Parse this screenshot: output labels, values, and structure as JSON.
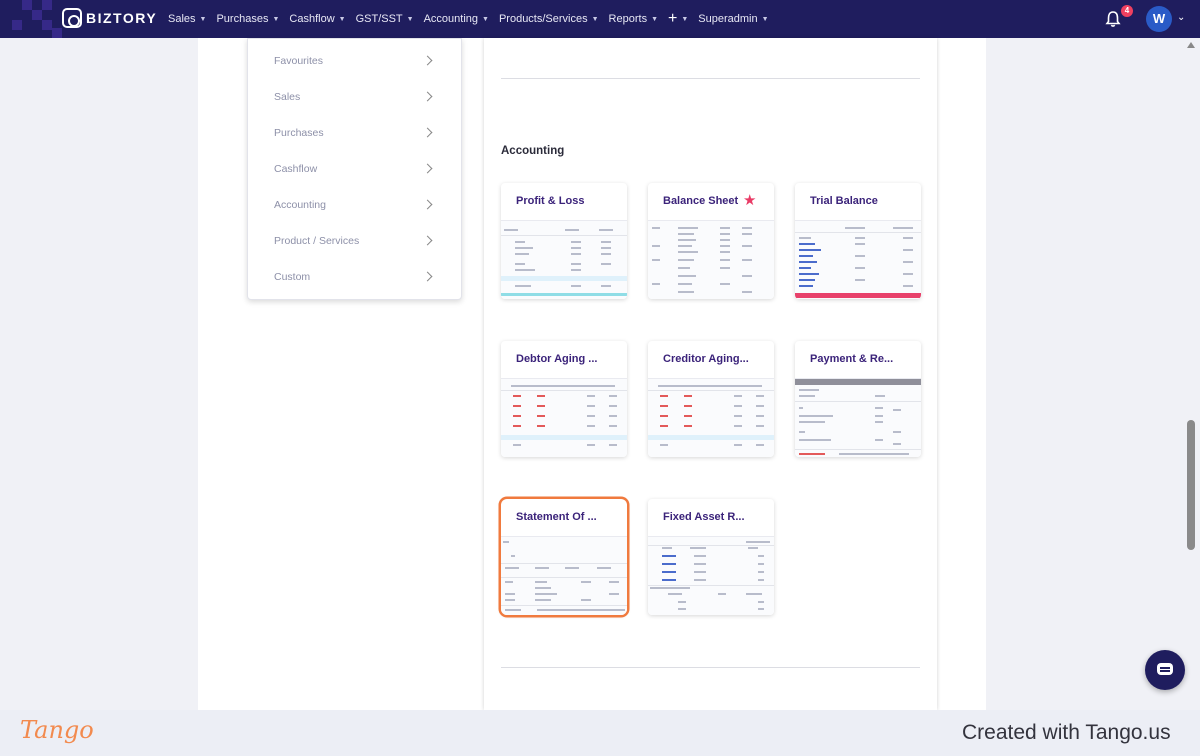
{
  "app": {
    "brand": "BIZTORY"
  },
  "nav": {
    "items": [
      "Sales",
      "Purchases",
      "Cashflow",
      "GST/SST",
      "Accounting",
      "Products/Services",
      "Reports"
    ],
    "plus": "+",
    "superadmin": "Superadmin",
    "notification_count": "4",
    "avatar_initial": "W"
  },
  "menu": {
    "items": [
      "Favourites",
      "Sales",
      "Purchases",
      "Cashflow",
      "Accounting",
      "Product / Services",
      "Custom"
    ]
  },
  "section": {
    "title": "Accounting"
  },
  "reports": [
    {
      "title": "Profit & Loss",
      "favourite": false
    },
    {
      "title": "Balance Sheet",
      "favourite": true
    },
    {
      "title": "Trial Balance",
      "favourite": false
    },
    {
      "title": "Debtor Aging ...",
      "favourite": false
    },
    {
      "title": "Creditor Aging...",
      "favourite": false
    },
    {
      "title": "Payment & Re...",
      "favourite": false
    },
    {
      "title": "Statement Of ...",
      "favourite": false,
      "highlighted": true
    },
    {
      "title": "Fixed Asset R...",
      "favourite": false
    }
  ],
  "icons": {
    "favourite": "star-icon",
    "bell": "bell-icon",
    "chat": "chat-icon",
    "chevron": "chevron-right-icon"
  },
  "colors": {
    "nav_bg": "#1f1d5e",
    "card_title": "#3b237a",
    "star": "#e93b66",
    "highlight": "#f07a3e",
    "badge": "#ef4060"
  },
  "footer": {
    "tango": "Tango",
    "created": "Created with Tango.us"
  }
}
